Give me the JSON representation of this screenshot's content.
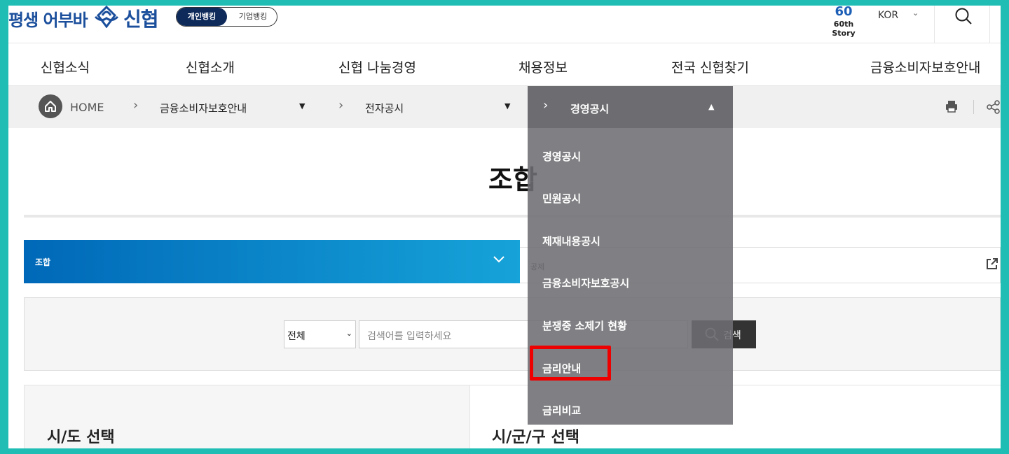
{
  "header": {
    "slogan": "평생 어부바",
    "brand": "신협",
    "bank_toggle": {
      "personal": "개인뱅킹",
      "corporate": "기업뱅킹"
    },
    "story": {
      "number": "60",
      "label": "60th Story"
    },
    "language": "KOR"
  },
  "gnb": {
    "items": [
      "신협소식",
      "신협소개",
      "신협 나눔경영",
      "채용정보",
      "전국 신협찾기",
      "금융소비자보호안내"
    ]
  },
  "breadcrumb": {
    "home": "HOME",
    "level1": "금융소비자보호안내",
    "level2": "전자공시",
    "level3": "경영공시"
  },
  "page": {
    "title": "조합"
  },
  "tabs": {
    "active": "조합",
    "other": "공제"
  },
  "search": {
    "select_value": "전체",
    "placeholder": "검색어를 입력하세요",
    "button": "검색"
  },
  "panels": {
    "left_title": "시/도 선택",
    "right_title": "시/군/구 선택"
  },
  "dropdown": {
    "items": [
      "경영공시",
      "민원공시",
      "제재내용공시",
      "금융소비자보호공시",
      "분쟁중 소제기 현황",
      "금리안내",
      "금리비교"
    ],
    "highlighted": "금리안내"
  },
  "colors": {
    "frame": "#20bdb5",
    "brand_blue": "#1b4f9c",
    "tab_gradient_start": "#0068b8",
    "tab_gradient_end": "#16a3d9",
    "highlight": "#ee0000"
  }
}
